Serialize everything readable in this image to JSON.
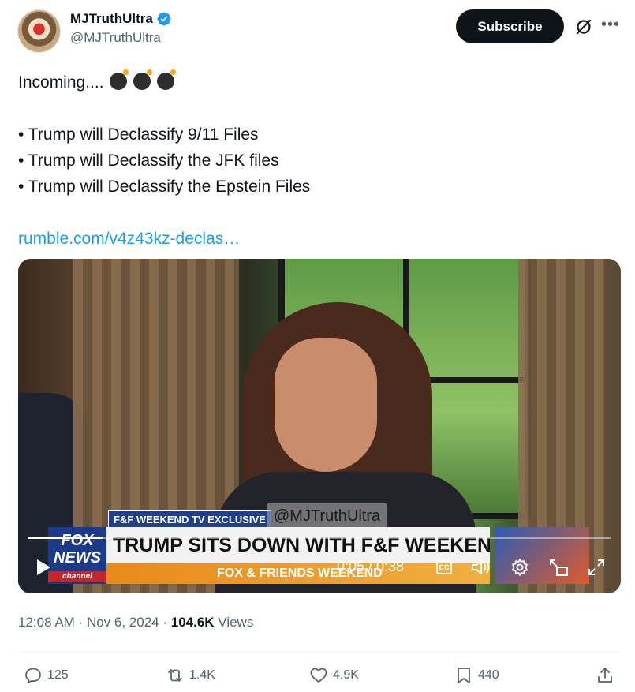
{
  "author": {
    "display_name": "MJTruthUltra",
    "handle": "@MJTruthUltra",
    "verified_icon": "verified-badge-icon",
    "verified_color": "#1d9bf0"
  },
  "header_actions": {
    "subscribe_label": "Subscribe",
    "grok_icon": "grok-icon",
    "more_icon": "more-icon"
  },
  "tweet": {
    "intro": "Incoming....",
    "bomb_icons": [
      "bomb-icon",
      "bomb-icon",
      "bomb-icon"
    ],
    "bullets": [
      "• Trump will Declassify 9/11 Files",
      "• Trump will Declassify the JFK files",
      "• Trump will Declassify the Epstein Files"
    ],
    "link": "rumble.com/v4z43kz-declas…"
  },
  "video": {
    "exclusive_tag": "F&F WEEKEND TV EXCLUSIVE",
    "watermark": "@MJTruthUltra",
    "fox_logo": "FOX NEWS",
    "fox_logo_sub": "channel",
    "headline": "TRUMP SITS DOWN WITH F&F WEEKEND",
    "subline": "FOX & FRIENDS WEEKEND",
    "time": "0:05 / 0:38",
    "progress": 0.13,
    "cc_label": "CC"
  },
  "meta": {
    "time": "12:08 AM",
    "separator": " · ",
    "date": "Nov 6, 2024",
    "views_count": "104.6K",
    "views_label": "Views"
  },
  "actions": {
    "replies": "125",
    "reposts": "1.4K",
    "likes": "4.9K",
    "bookmarks": "440"
  }
}
